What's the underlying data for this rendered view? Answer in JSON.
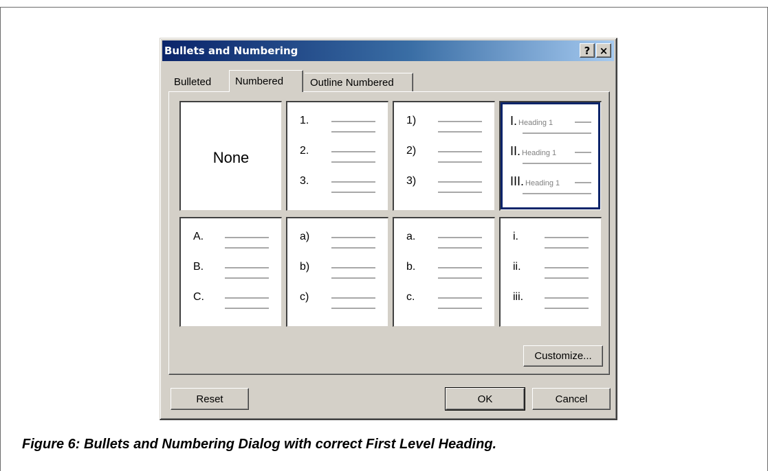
{
  "dialog": {
    "title": "Bullets and Numbering",
    "help_label": "?",
    "close_label": "×",
    "tabs": [
      {
        "label": "Bulleted",
        "active": false
      },
      {
        "label": "Numbered",
        "active": true
      },
      {
        "label": "Outline Numbered",
        "active": false
      }
    ],
    "none_label": "None",
    "styles": [
      {
        "markers": [
          "1.",
          "2.",
          "3."
        ]
      },
      {
        "markers": [
          "1)",
          "2)",
          "3)"
        ]
      },
      {
        "markers": [
          "I.",
          "II.",
          "III."
        ],
        "heading_text": "Heading 1",
        "selected": true
      },
      {
        "markers": [
          "A.",
          "B.",
          "C."
        ]
      },
      {
        "markers": [
          "a)",
          "b)",
          "c)"
        ]
      },
      {
        "markers": [
          "a.",
          "b.",
          "c."
        ]
      },
      {
        "markers": [
          "i.",
          "ii.",
          "iii."
        ]
      }
    ],
    "customize_label": "Customize...",
    "reset_label": "Reset",
    "ok_label": "OK",
    "cancel_label": "Cancel"
  },
  "caption": "Figure 6: Bullets and Numbering Dialog with correct First Level Heading.",
  "colors": {
    "title_gradient_start": "#0a246a",
    "title_gradient_end": "#a6caf0",
    "dialog_face": "#d4d0c8",
    "selection_border": "#0a246a"
  }
}
